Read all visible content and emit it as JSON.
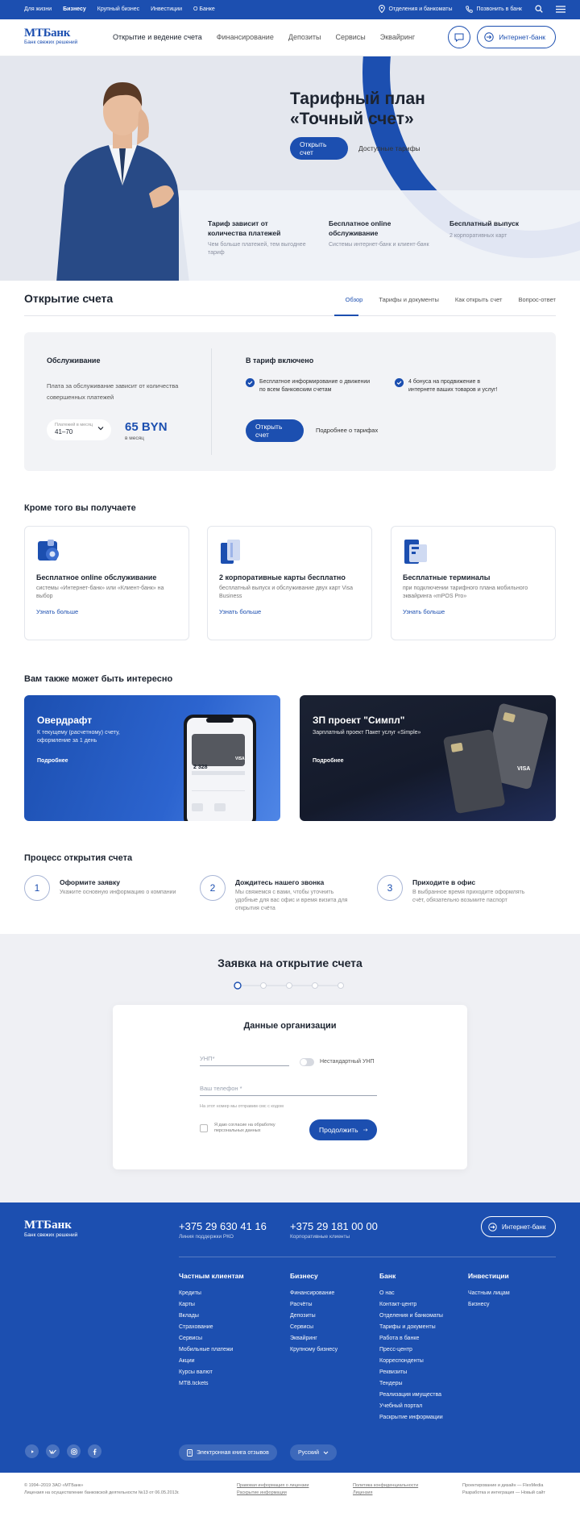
{
  "topbar": {
    "links": [
      "Для жизни",
      "Бизнесу",
      "Крупный бизнес",
      "Инвестиции",
      "О Банке"
    ],
    "offices": "Отделения и банкоматы",
    "call": "Позвонить в банк"
  },
  "header": {
    "logo": "МТБанк",
    "tagline": "Банк свежих решений",
    "nav": [
      "Открытие и ведение счета",
      "Финансирование",
      "Депозиты",
      "Сервисы",
      "Эквайринг"
    ],
    "internet_bank": "Интернет-банк"
  },
  "hero": {
    "title": "Тарифный план «Точный счет»",
    "open_button": "Открыть счет",
    "tariffs_link": "Доступные тарифы",
    "features": [
      {
        "title": "Тариф зависит от количества платежей",
        "desc": "Чем больше платежей, тем выгоднее тариф"
      },
      {
        "title": "Бесплатное online обслуживание",
        "desc": "Системы интернет-банк и клиент-банк"
      },
      {
        "title": "Бесплатный выпуск",
        "desc": "2 корпоративных карт"
      }
    ]
  },
  "account": {
    "title": "Открытие счета",
    "tabs": [
      "Обзор",
      "Тарифы и документы",
      "Как открыть счет",
      "Вопрос-ответ"
    ],
    "service_title": "Обслуживание",
    "service_desc": "Плата за обслуживание зависит от количества совершенных платежей",
    "select_label": "Платежей в месяц",
    "select_value": "41–70",
    "price": "65 BYN",
    "per": "в месяц",
    "included_title": "В тариф включено",
    "included": [
      "Бесплатное информирование о движении по всем банковским счетам",
      "4 бонуса на продвижение в интернете ваших товаров и услуг!"
    ],
    "open_button": "Открыть счет",
    "more_link": "Подробнее о тарифах"
  },
  "extras": {
    "title": "Кроме того вы получаете",
    "cards": [
      {
        "title": "Бесплатное online обслуживание",
        "desc": "системы «Интернет-банк» или «Клиент-банк» на выбор",
        "link": "Узнать больше"
      },
      {
        "title": "2 корпоративные карты бесплатно",
        "desc": "бесплатный выпуск и обслуживание двух карт Visa Business",
        "link": "Узнать больше"
      },
      {
        "title": "Бесплатные терминалы",
        "desc": "при подключении тарифного плана мобильного эквайринга «mPOS Pro»",
        "link": "Узнать больше"
      }
    ]
  },
  "interest": {
    "title": "Вам также может быть интересно",
    "promos": [
      {
        "title": "Овердрафт",
        "desc": "К текущему (расчетному) счету, оформление за 1 день",
        "link": "Подробнее",
        "phone_amount": "2 328",
        "phone_card": "VISA"
      },
      {
        "title": "ЗП проект \"Симпл\"",
        "desc": "Зарплатный проект Пакет услуг «Simple»",
        "link": "Подробнее",
        "card_brand": "VISA"
      }
    ]
  },
  "process": {
    "title": "Процесс открытия счета",
    "steps": [
      {
        "num": "1",
        "title": "Оформите заявку",
        "desc": "Укажите основную информацию о компании"
      },
      {
        "num": "2",
        "title": "Дождитесь нашего звонка",
        "desc": "Мы свяжемся с вами, чтобы уточнить удобные для вас офис и время визита для открытия счёта"
      },
      {
        "num": "3",
        "title": "Приходите в офис",
        "desc": "В выбранное время приходите оформлять счёт, обязательно возьмите паспорт"
      }
    ]
  },
  "application": {
    "title": "Заявка на открытие счета",
    "form_title": "Данные организации",
    "unp_placeholder": "УНП*",
    "nonstandard_label": "Нестандартный УНП",
    "phone_placeholder": "Ваш телефон *",
    "phone_hint": "На этот номер мы отправим смс с кодом",
    "consent": "Я даю согласие на обработку персональных данных",
    "continue_button": "Продолжить"
  },
  "footer": {
    "logo": "МТБанк",
    "tagline": "Банк свежих решений",
    "phone1": "+375 29 630 41 16",
    "phone1_label": "Линия поддержки РКО",
    "phone2": "+375 29 181 00 00",
    "phone2_label": "Корпоративные клиенты",
    "internet_bank": "Интернет-банк",
    "columns": [
      {
        "title": "Частным клиентам",
        "items": [
          "Кредиты",
          "Карты",
          "Вклады",
          "Страхование",
          "Сервисы",
          "Мобильные платежи",
          "Акции",
          "Курсы валют",
          "MTB.tickets"
        ]
      },
      {
        "title": "Бизнесу",
        "items": [
          "Финансирование",
          "Расчёты",
          "Депозиты",
          "Сервисы",
          "Эквайринг",
          "Крупному бизнесу"
        ]
      },
      {
        "title": "Банк",
        "items": [
          "О нас",
          "Контакт-центр",
          "Отделения и банкоматы",
          "Тарифы и документы",
          "Работа в банке",
          "Пресс-центр",
          "Корреспонденты",
          "Реквизиты",
          "Тендеры",
          "Реализация имущества",
          "Учебный портал",
          "Раскрытие информации"
        ]
      },
      {
        "title": "Инвестиции",
        "items": [
          "Частным лицам",
          "Бизнесу"
        ]
      }
    ],
    "review_book": "Электронная книга отзывов",
    "language": "Русский"
  },
  "bottom": {
    "copyright": "© 1994–2019 ЗАО «МТБанк»",
    "license": "Лицензия на осуществление банковской деятельности №13 от 06.05.2013г.",
    "legal1": "Правовая информация о лицензии",
    "legal2": "Раскрытие информации",
    "privacy1": "Политика конфиденциальности",
    "privacy2": "Лицензия",
    "design": "Проектирование и дизайн — FlexMedia",
    "dev": "Разработка и интеграция — Новый сайт"
  },
  "colors": {
    "brand_blue": "#1c4fb0",
    "background_gray": "#f2f3f6"
  }
}
